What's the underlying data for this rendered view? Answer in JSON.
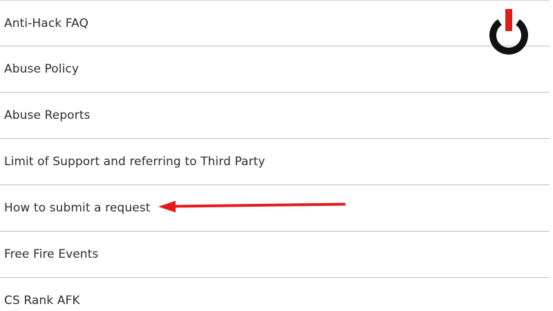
{
  "list": {
    "items": [
      {
        "label": "Anti-Hack FAQ"
      },
      {
        "label": "Abuse Policy"
      },
      {
        "label": "Abuse Reports"
      },
      {
        "label": "Limit of Support and referring to Third Party"
      },
      {
        "label": "How to submit a request"
      },
      {
        "label": "Free Fire Events"
      },
      {
        "label": "CS Rank AFK"
      }
    ]
  },
  "logo": {
    "icon": "power-icon",
    "ring_color": "#111111",
    "accent_color": "#e41b1b"
  },
  "annotation": {
    "icon": "arrow-left-icon",
    "color": "#e41b1b"
  }
}
